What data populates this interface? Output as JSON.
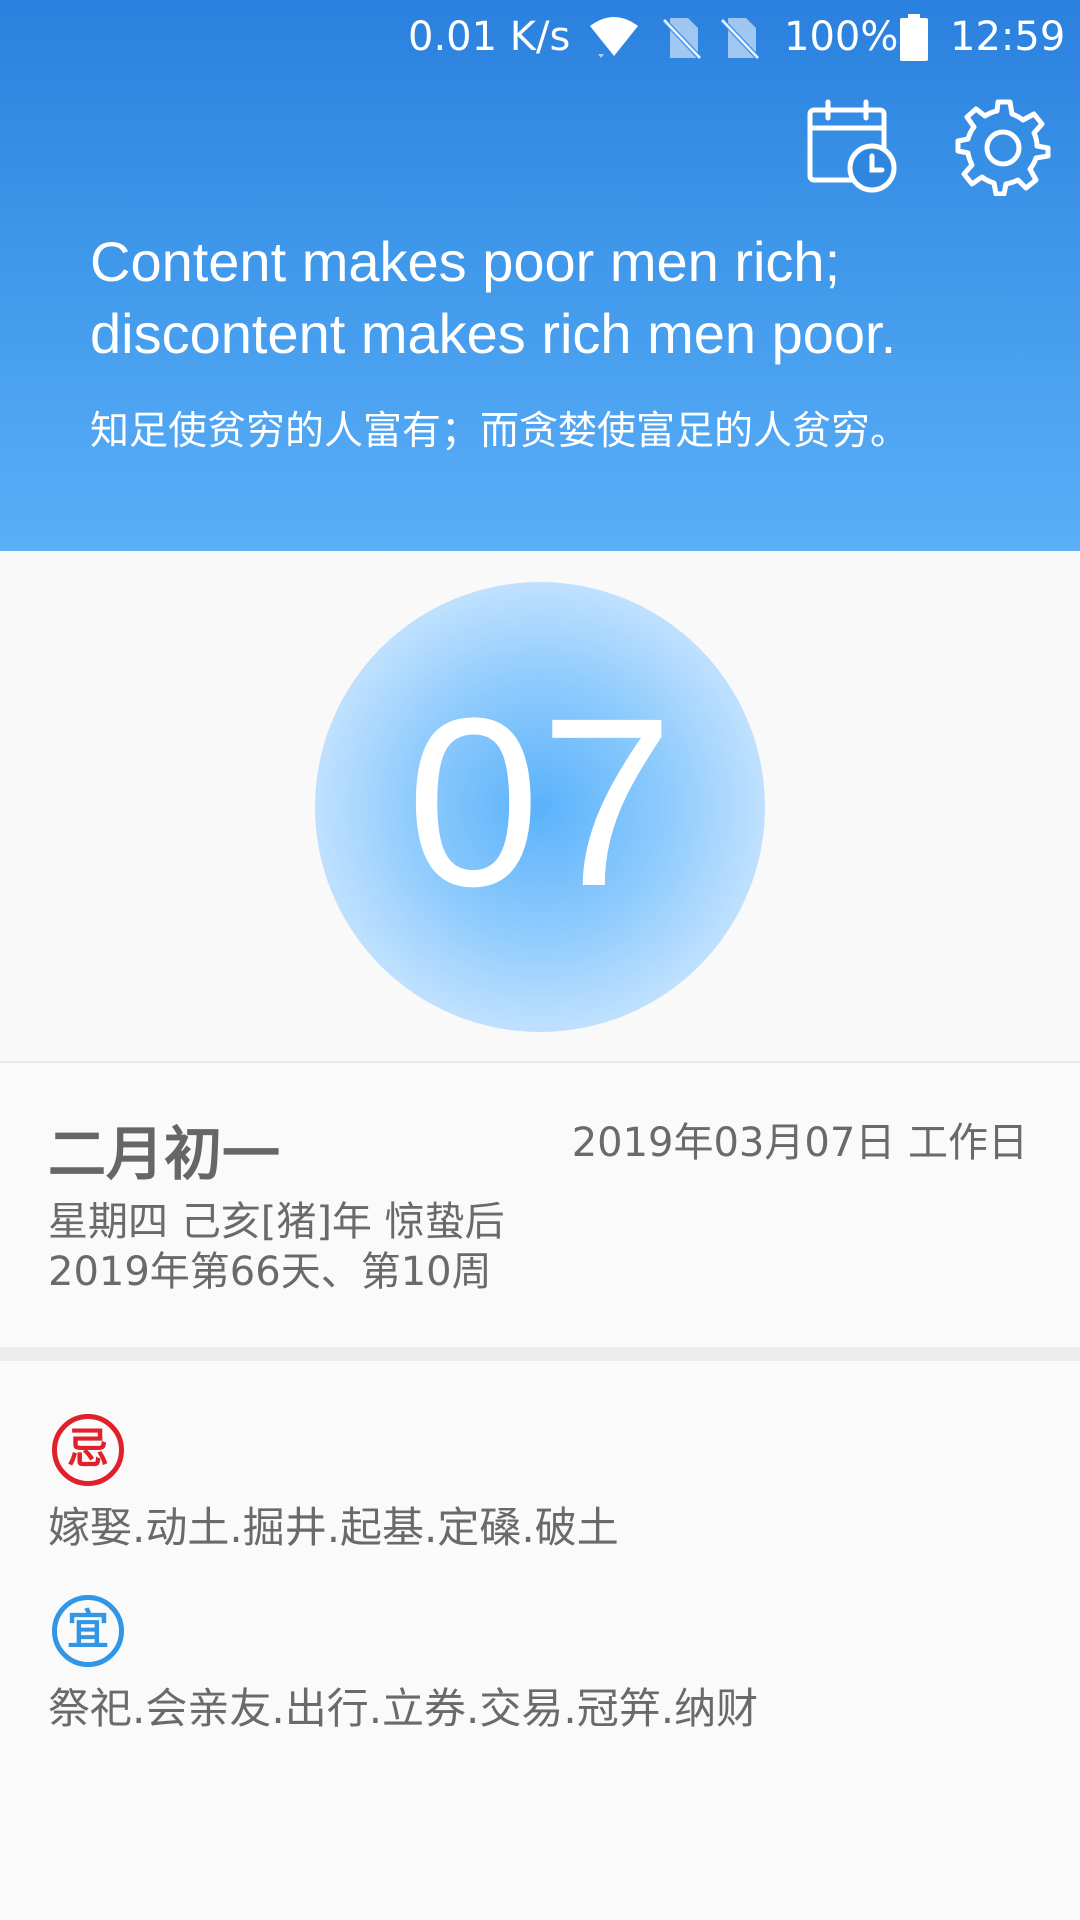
{
  "status_bar": {
    "network_speed": "0.01 K/s",
    "battery_percent": "100%",
    "time": "12:59",
    "icons": [
      "wifi-icon",
      "no-sim-icon",
      "no-sim-icon",
      "battery-icon"
    ]
  },
  "toolbar": {
    "icons": [
      "calendar-clock-icon",
      "gear-icon"
    ]
  },
  "quote": {
    "english": "Content makes poor men rich; discontent makes rich men poor.",
    "chinese": "知足使贫穷的人富有；而贪婪使富足的人贫穷。"
  },
  "day": {
    "number": "07"
  },
  "date_info": {
    "lunar_date": "二月初一",
    "gregorian_date": "2019年03月07日 工作日",
    "line1": "星期四 己亥[猪]年 惊蛰后",
    "line2": "2019年第66天、第10周"
  },
  "almanac": {
    "avoid": {
      "badge": "忌",
      "items": "嫁娶.动土.掘井.起基.定磉.破土"
    },
    "suitable": {
      "badge": "宜",
      "items": "祭祀.会亲友.出行.立券.交易.冠笄.纳财"
    }
  },
  "colors": {
    "header_top": "#2a80dd",
    "header_bottom": "#5aaff7",
    "avoid_red": "#e0202a",
    "suitable_blue": "#3296e6",
    "text_gray": "#6a6a6a"
  }
}
